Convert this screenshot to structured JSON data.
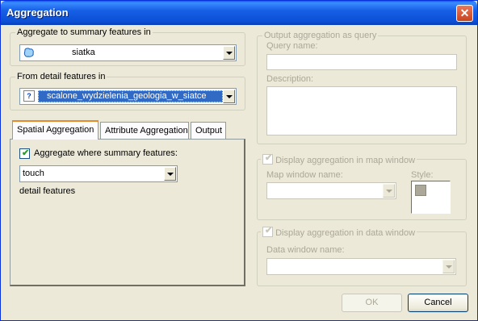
{
  "window": {
    "title": "Aggregation"
  },
  "summary_group": {
    "legend": "Aggregate to summary features in",
    "selected": "siatka"
  },
  "detail_group": {
    "legend": "From detail features in",
    "selected": "scalone_wydzielenia_geologia_w_siatce"
  },
  "tabs": [
    {
      "label": "Spatial Aggregation",
      "active": true
    },
    {
      "label": "Attribute Aggregation",
      "active": false
    },
    {
      "label": "Output",
      "active": false
    }
  ],
  "spatial": {
    "checkbox_label": "Aggregate where summary features:",
    "checked": true,
    "relation": "touch",
    "suffix_text": "detail features"
  },
  "query_group": {
    "legend": "Output aggregation as query",
    "query_name_label": "Query name:",
    "description_label": "Description:"
  },
  "map_group": {
    "legend": "Display aggregation in map window",
    "checked": true,
    "map_window_label": "Map window name:",
    "style_label": "Style:"
  },
  "data_group": {
    "legend": "Display aggregation in data window",
    "checked": true,
    "data_window_label": "Data window name:"
  },
  "buttons": {
    "ok": "OK",
    "cancel": "Cancel"
  }
}
